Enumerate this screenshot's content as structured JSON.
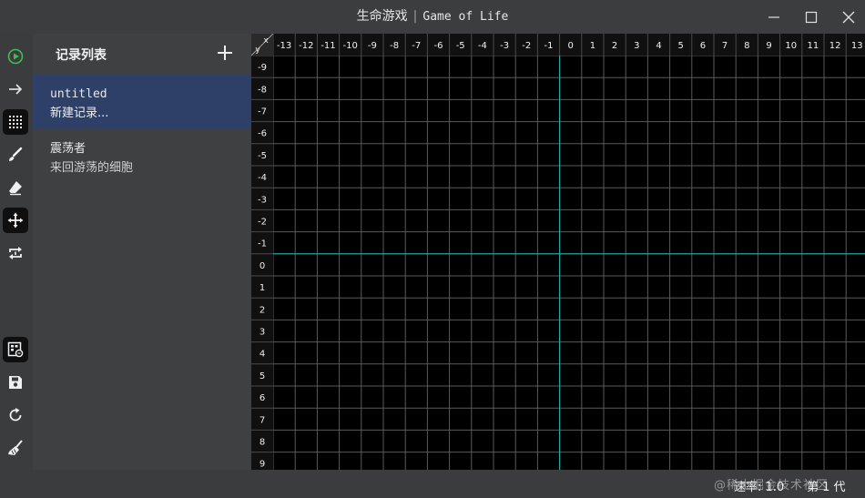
{
  "window": {
    "title_cn": "生命游戏",
    "title_sep": "|",
    "title_en": "Game of Life"
  },
  "toolbar": {
    "tools": [
      {
        "name": "play",
        "icon": "play-circle-icon",
        "active": false
      },
      {
        "name": "step",
        "icon": "arrow-right-icon",
        "active": false
      },
      {
        "name": "grid",
        "icon": "grid-dots-icon",
        "active": true
      },
      {
        "name": "brush",
        "icon": "brush-icon",
        "active": false
      },
      {
        "name": "eraser",
        "icon": "eraser-icon",
        "active": false
      },
      {
        "name": "move",
        "icon": "move-arrows-icon",
        "active": true
      },
      {
        "name": "transform",
        "icon": "rotate-flip-icon",
        "active": false
      },
      {
        "name": "export",
        "icon": "image-export-icon",
        "active": true
      },
      {
        "name": "save",
        "icon": "save-icon",
        "active": false
      },
      {
        "name": "reset",
        "icon": "refresh-icon",
        "active": false
      },
      {
        "name": "clear",
        "icon": "broom-icon",
        "active": false
      }
    ]
  },
  "panel": {
    "title": "记录列表",
    "add_icon": "plus-icon",
    "records": [
      {
        "name": "untitled",
        "desc": "新建记录...",
        "selected": true
      },
      {
        "name": "震荡者",
        "desc": "来回游荡的细胞",
        "selected": false
      }
    ]
  },
  "grid": {
    "corner_x": "x",
    "corner_y": "y",
    "x_labels": [
      "-13",
      "-12",
      "-11",
      "-10",
      "-9",
      "-8",
      "-7",
      "-6",
      "-5",
      "-4",
      "-3",
      "-2",
      "-1",
      "0",
      "1",
      "2",
      "3",
      "4",
      "5",
      "6",
      "7",
      "8",
      "9",
      "10",
      "11",
      "12",
      "13"
    ],
    "y_labels": [
      "-9",
      "-8",
      "-7",
      "-6",
      "-5",
      "-4",
      "-3",
      "-2",
      "-1",
      "0",
      "1",
      "2",
      "3",
      "4",
      "5",
      "6",
      "7",
      "8",
      "9"
    ],
    "axis_color": "#1fa8a0",
    "line_color": "#5a5a5a",
    "header_bg": "#101010"
  },
  "status": {
    "speed": "速率: 1.0",
    "generation": "第 1 代",
    "watermark": "@稀土掘金技术社区"
  }
}
